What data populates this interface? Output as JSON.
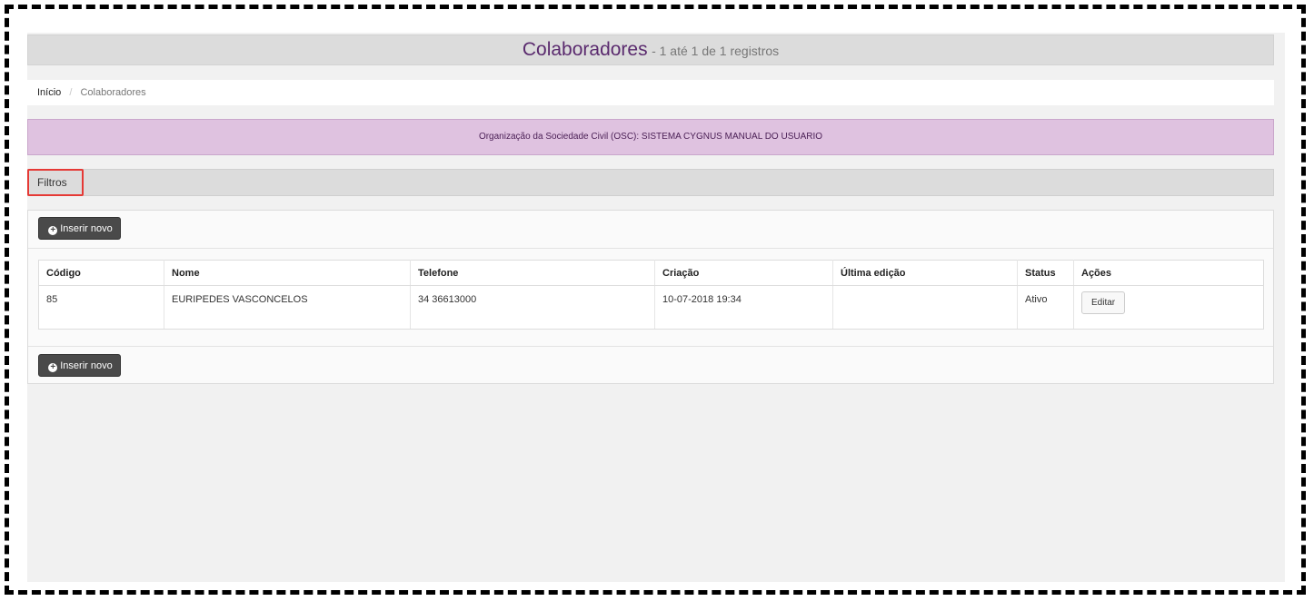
{
  "header": {
    "title": "Colaboradores",
    "subtitle": "- 1 até 1 de 1 registros"
  },
  "breadcrumb": {
    "home": "Início",
    "separator": "/",
    "current": "Colaboradores"
  },
  "organization_banner": "Organização da Sociedade Civil (OSC): SISTEMA CYGNUS MANUAL DO USUARIO",
  "filters": {
    "label": "Filtros"
  },
  "actions": {
    "insert_label": "Inserir novo",
    "insert_icon": "plus-circle-icon"
  },
  "table": {
    "columns": [
      "Código",
      "Nome",
      "Telefone",
      "Criação",
      "Última edição",
      "Status",
      "Ações"
    ],
    "rows": [
      {
        "codigo": "85",
        "nome": "EURIPEDES VASCONCELOS",
        "telefone": "34 36613000",
        "criacao": "10-07-2018 19:34",
        "ultima_edicao": "",
        "status": "Ativo",
        "acao_label": "Editar"
      }
    ]
  },
  "colors": {
    "title": "#5a2a6e",
    "banner_bg": "#dfc2e0",
    "status_active": "#2e8b2e",
    "button_dark": "#4a4a4a",
    "highlight_box": "#e53935"
  }
}
